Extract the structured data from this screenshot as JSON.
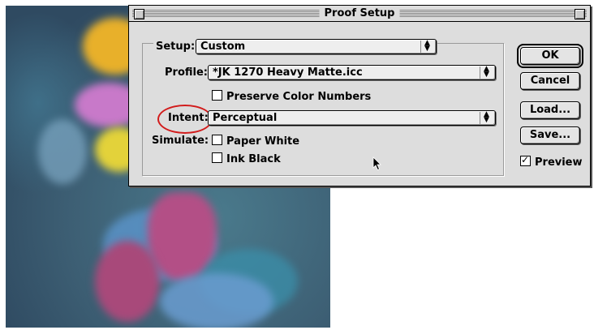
{
  "window": {
    "title": "Proof Setup"
  },
  "form": {
    "setup_label": "Setup:",
    "setup_value": "Custom",
    "profile_label": "Profile:",
    "profile_value": "*JK 1270 Heavy Matte.icc",
    "preserve_label": "Preserve Color Numbers",
    "preserve_checked": false,
    "intent_label": "Intent:",
    "intent_value": "Perceptual",
    "simulate_label": "Simulate:",
    "paper_white_label": "Paper White",
    "paper_white_checked": false,
    "ink_black_label": "Ink Black",
    "ink_black_checked": false
  },
  "buttons": {
    "ok": "OK",
    "cancel": "Cancel",
    "load": "Load...",
    "save": "Save...",
    "preview_label": "Preview",
    "preview_checked": true
  },
  "colors": {
    "dialog_bg": "#dddddd",
    "highlight_ring": "#d21c1c"
  },
  "icons": {
    "popup_arrow": "up-down-arrows-icon",
    "cursor": "arrow-cursor-icon"
  }
}
